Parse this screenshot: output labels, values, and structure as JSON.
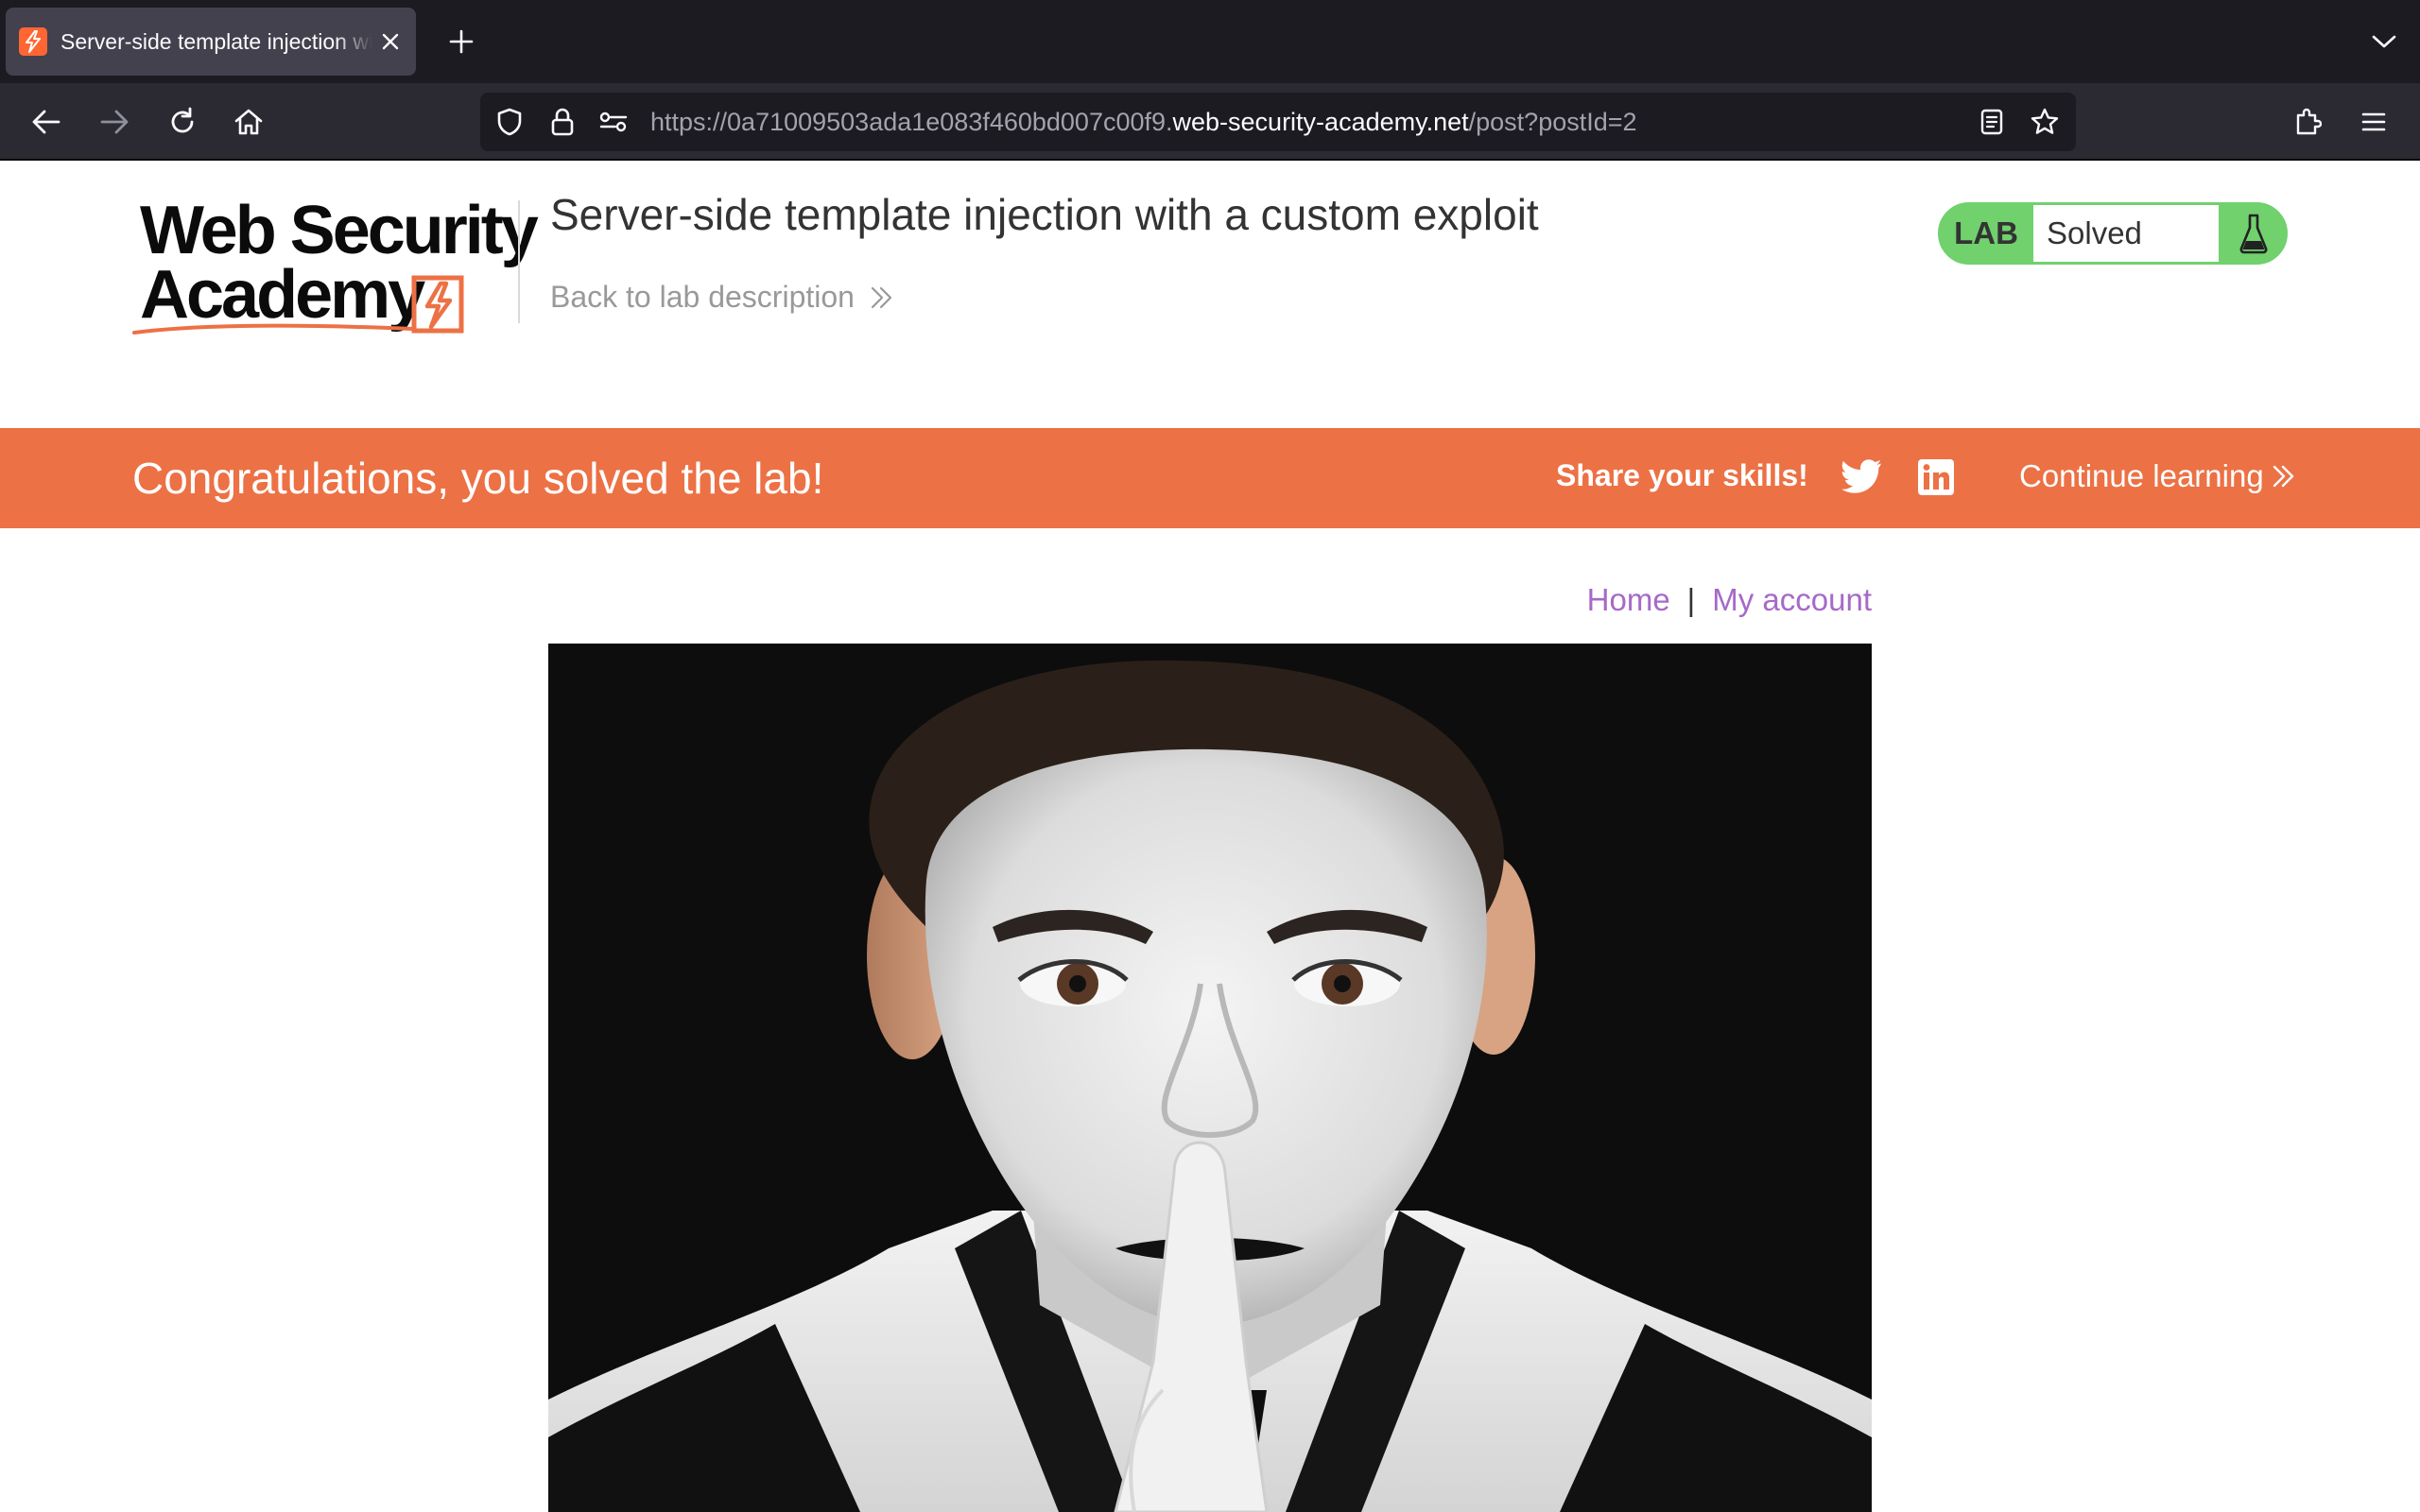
{
  "browser": {
    "tab_title": "Server-side template injection with a custom exploit",
    "url_prefix": "https://0a71009503ada1e083f460bd007c00f9.",
    "url_domain": "web-security-academy.net",
    "url_path": "/post?postId=2"
  },
  "logo": {
    "line1": "Web Security",
    "line2": "Academy"
  },
  "header": {
    "title": "Server-side template injection with a custom exploit",
    "back_link": "Back to lab description"
  },
  "lab_status": {
    "label": "LAB",
    "value": "Solved"
  },
  "banner": {
    "message": "Congratulations, you solved the lab!",
    "share": "Share your skills!",
    "continue": "Continue learning"
  },
  "nav": {
    "home": "Home",
    "separator": "|",
    "account": "My account"
  },
  "colors": {
    "accent_orange": "#ec7145",
    "lab_green": "#70d16d",
    "link_purple": "#a669c8"
  }
}
